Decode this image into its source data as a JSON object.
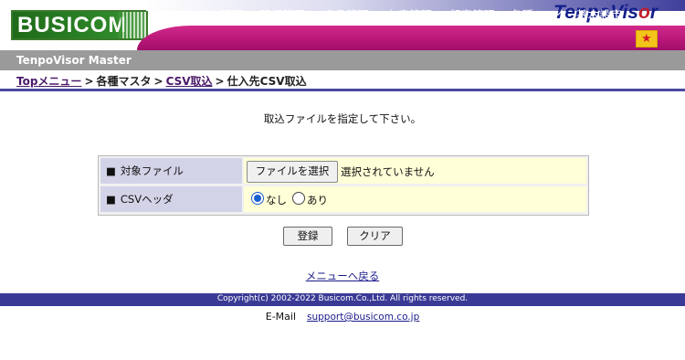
{
  "header": {
    "logo_text": "BUSICOM",
    "brand_parts": {
      "left": "TenpoVis",
      "accent": "o",
      "right": "r"
    },
    "nav_items": [
      "売上管理",
      "明細管理",
      "商品管理",
      "在庫管理",
      "顧客管理",
      "各種マスタ",
      "基本設定"
    ],
    "home_icon_glyph": "★"
  },
  "titlebar": {
    "title": "TenpoVisor Master"
  },
  "breadcrumb": {
    "top": "Topメニュー",
    "separator": ">",
    "masters": "各種マスタ",
    "csv": "CSV取込",
    "current": "仕入先CSV取込"
  },
  "main": {
    "instruction": "取込ファイルを指定して下さい。",
    "form": {
      "file_label": "対象ファイル",
      "file_button": "ファイルを選択",
      "file_status": "選択されていません",
      "header_label": "CSVヘッダ",
      "bullet": "■",
      "options": [
        {
          "label": "なし",
          "selected": true
        },
        {
          "label": "あり",
          "selected": false
        }
      ]
    },
    "buttons": {
      "save": "登録",
      "clear": "クリア"
    },
    "back_link": "メニューへ戻る"
  },
  "footer": {
    "copyright": "Copyright(c) 2002-2022 Busicom.Co.,Ltd. All rights reserved.",
    "email_label": "E-Mail",
    "email": "support@busicom.co.jp"
  },
  "colors": {
    "nav_magenta": "#b71678",
    "title_gray": "#9a9a9a",
    "label_cell": "#d3d3e8",
    "value_cell": "#ffffd8",
    "footer_navy": "#3a3a96",
    "logo_green": "#2f8a2a"
  }
}
